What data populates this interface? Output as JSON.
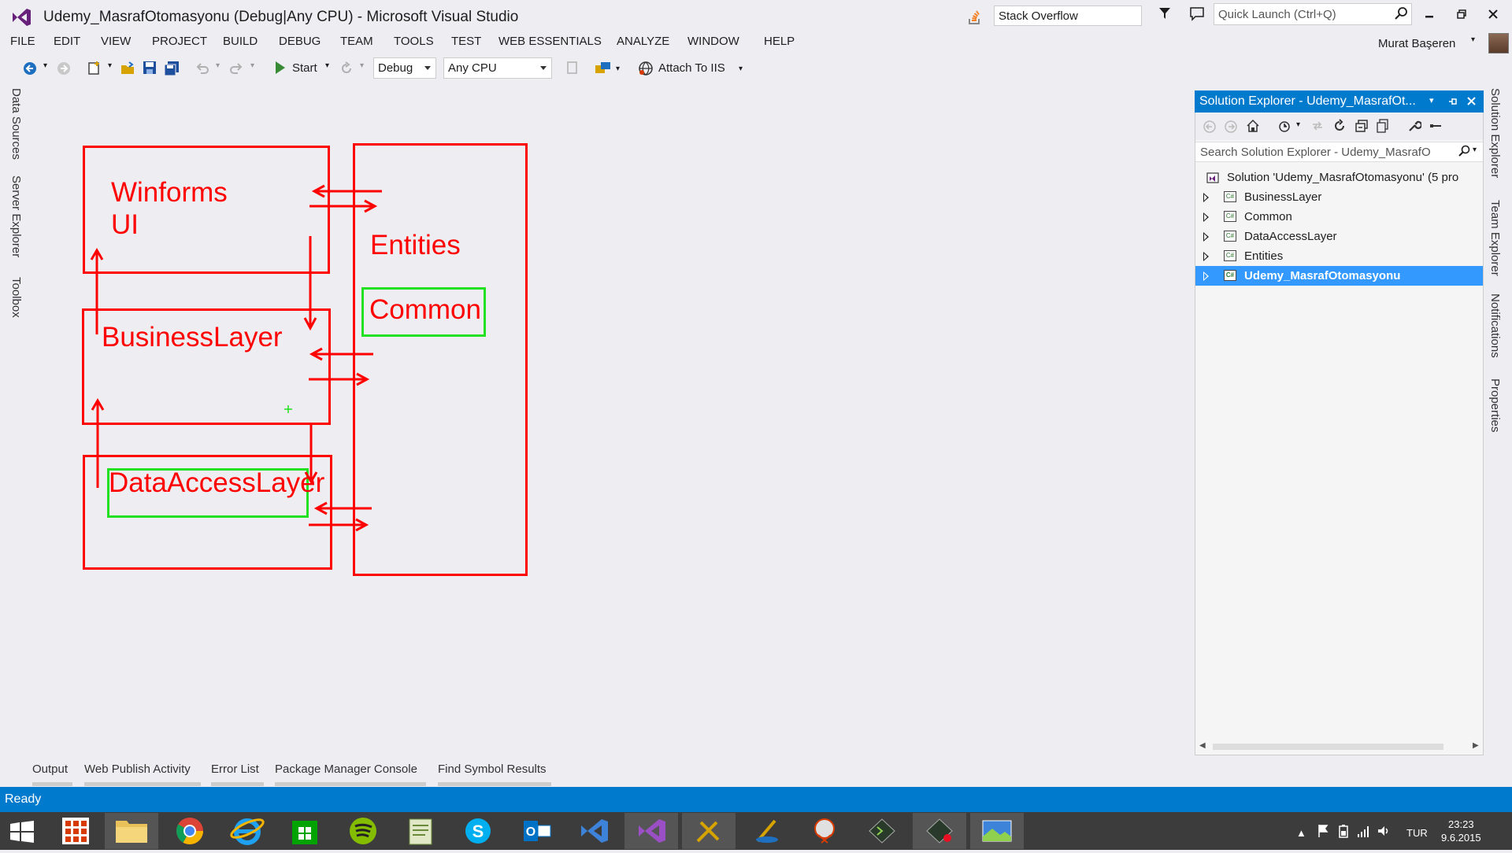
{
  "window": {
    "title": "Udemy_MasrafOtomasyonu (Debug|Any CPU) - Microsoft Visual Studio",
    "stack_overflow_label": "Stack Overflow",
    "quick_launch_placeholder": "Quick Launch (Ctrl+Q)",
    "user_name": "Murat Başeren"
  },
  "menu": [
    "FILE",
    "EDIT",
    "VIEW",
    "PROJECT",
    "BUILD",
    "DEBUG",
    "TEAM",
    "TOOLS",
    "TEST",
    "WEB ESSENTIALS",
    "ANALYZE",
    "WINDOW",
    "HELP"
  ],
  "toolbar": {
    "start_label": "Start",
    "config_value": "Debug",
    "platform_value": "Any CPU",
    "attach_label": "Attach To IIS"
  },
  "left_tabs": [
    "Data Sources",
    "Server Explorer",
    "Toolbox"
  ],
  "right_tabs": [
    "Solution Explorer",
    "Team Explorer",
    "Notifications",
    "Properties"
  ],
  "diagram": {
    "winforms": "Winforms",
    "ui": "UI",
    "business": "BusinessLayer",
    "dataaccess": "DataAccessLayer",
    "entities": "Entities",
    "common": "Common"
  },
  "solution_explorer": {
    "title": "Solution Explorer - Udemy_MasrafOt...",
    "search_placeholder": "Search Solution Explorer - Udemy_MasrafO",
    "solution_label": "Solution 'Udemy_MasrafOtomasyonu' (5 pro",
    "projects": [
      "BusinessLayer",
      "Common",
      "DataAccessLayer",
      "Entities",
      "Udemy_MasrafOtomasyonu"
    ],
    "selected_project": "Udemy_MasrafOtomasyonu"
  },
  "bottom_tabs": [
    "Output",
    "Web Publish Activity",
    "Error List",
    "Package Manager Console",
    "Find Symbol Results"
  ],
  "status": "Ready",
  "taskbar": {
    "language": "TUR",
    "time": "23:23",
    "date": "9.6.2015"
  },
  "colors": {
    "accent": "#007acc",
    "diagram_red": "#ff0000",
    "diagram_green": "#22e022",
    "vs_purple": "#68217a"
  }
}
